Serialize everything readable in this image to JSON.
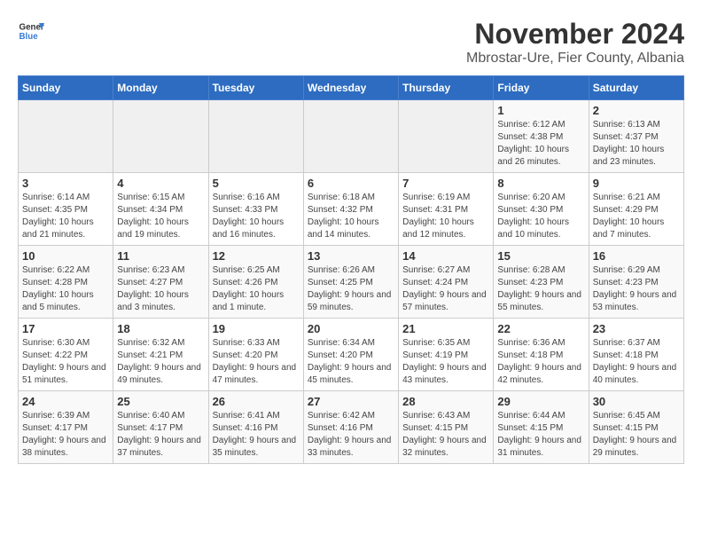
{
  "header": {
    "logo_general": "General",
    "logo_blue": "Blue",
    "main_title": "November 2024",
    "subtitle": "Mbrostar-Ure, Fier County, Albania"
  },
  "calendar": {
    "days_of_week": [
      "Sunday",
      "Monday",
      "Tuesday",
      "Wednesday",
      "Thursday",
      "Friday",
      "Saturday"
    ],
    "weeks": [
      [
        {
          "day": "",
          "info": ""
        },
        {
          "day": "",
          "info": ""
        },
        {
          "day": "",
          "info": ""
        },
        {
          "day": "",
          "info": ""
        },
        {
          "day": "",
          "info": ""
        },
        {
          "day": "1",
          "info": "Sunrise: 6:12 AM\nSunset: 4:38 PM\nDaylight: 10 hours and 26 minutes."
        },
        {
          "day": "2",
          "info": "Sunrise: 6:13 AM\nSunset: 4:37 PM\nDaylight: 10 hours and 23 minutes."
        }
      ],
      [
        {
          "day": "3",
          "info": "Sunrise: 6:14 AM\nSunset: 4:35 PM\nDaylight: 10 hours and 21 minutes."
        },
        {
          "day": "4",
          "info": "Sunrise: 6:15 AM\nSunset: 4:34 PM\nDaylight: 10 hours and 19 minutes."
        },
        {
          "day": "5",
          "info": "Sunrise: 6:16 AM\nSunset: 4:33 PM\nDaylight: 10 hours and 16 minutes."
        },
        {
          "day": "6",
          "info": "Sunrise: 6:18 AM\nSunset: 4:32 PM\nDaylight: 10 hours and 14 minutes."
        },
        {
          "day": "7",
          "info": "Sunrise: 6:19 AM\nSunset: 4:31 PM\nDaylight: 10 hours and 12 minutes."
        },
        {
          "day": "8",
          "info": "Sunrise: 6:20 AM\nSunset: 4:30 PM\nDaylight: 10 hours and 10 minutes."
        },
        {
          "day": "9",
          "info": "Sunrise: 6:21 AM\nSunset: 4:29 PM\nDaylight: 10 hours and 7 minutes."
        }
      ],
      [
        {
          "day": "10",
          "info": "Sunrise: 6:22 AM\nSunset: 4:28 PM\nDaylight: 10 hours and 5 minutes."
        },
        {
          "day": "11",
          "info": "Sunrise: 6:23 AM\nSunset: 4:27 PM\nDaylight: 10 hours and 3 minutes."
        },
        {
          "day": "12",
          "info": "Sunrise: 6:25 AM\nSunset: 4:26 PM\nDaylight: 10 hours and 1 minute."
        },
        {
          "day": "13",
          "info": "Sunrise: 6:26 AM\nSunset: 4:25 PM\nDaylight: 9 hours and 59 minutes."
        },
        {
          "day": "14",
          "info": "Sunrise: 6:27 AM\nSunset: 4:24 PM\nDaylight: 9 hours and 57 minutes."
        },
        {
          "day": "15",
          "info": "Sunrise: 6:28 AM\nSunset: 4:23 PM\nDaylight: 9 hours and 55 minutes."
        },
        {
          "day": "16",
          "info": "Sunrise: 6:29 AM\nSunset: 4:23 PM\nDaylight: 9 hours and 53 minutes."
        }
      ],
      [
        {
          "day": "17",
          "info": "Sunrise: 6:30 AM\nSunset: 4:22 PM\nDaylight: 9 hours and 51 minutes."
        },
        {
          "day": "18",
          "info": "Sunrise: 6:32 AM\nSunset: 4:21 PM\nDaylight: 9 hours and 49 minutes."
        },
        {
          "day": "19",
          "info": "Sunrise: 6:33 AM\nSunset: 4:20 PM\nDaylight: 9 hours and 47 minutes."
        },
        {
          "day": "20",
          "info": "Sunrise: 6:34 AM\nSunset: 4:20 PM\nDaylight: 9 hours and 45 minutes."
        },
        {
          "day": "21",
          "info": "Sunrise: 6:35 AM\nSunset: 4:19 PM\nDaylight: 9 hours and 43 minutes."
        },
        {
          "day": "22",
          "info": "Sunrise: 6:36 AM\nSunset: 4:18 PM\nDaylight: 9 hours and 42 minutes."
        },
        {
          "day": "23",
          "info": "Sunrise: 6:37 AM\nSunset: 4:18 PM\nDaylight: 9 hours and 40 minutes."
        }
      ],
      [
        {
          "day": "24",
          "info": "Sunrise: 6:39 AM\nSunset: 4:17 PM\nDaylight: 9 hours and 38 minutes."
        },
        {
          "day": "25",
          "info": "Sunrise: 6:40 AM\nSunset: 4:17 PM\nDaylight: 9 hours and 37 minutes."
        },
        {
          "day": "26",
          "info": "Sunrise: 6:41 AM\nSunset: 4:16 PM\nDaylight: 9 hours and 35 minutes."
        },
        {
          "day": "27",
          "info": "Sunrise: 6:42 AM\nSunset: 4:16 PM\nDaylight: 9 hours and 33 minutes."
        },
        {
          "day": "28",
          "info": "Sunrise: 6:43 AM\nSunset: 4:15 PM\nDaylight: 9 hours and 32 minutes."
        },
        {
          "day": "29",
          "info": "Sunrise: 6:44 AM\nSunset: 4:15 PM\nDaylight: 9 hours and 31 minutes."
        },
        {
          "day": "30",
          "info": "Sunrise: 6:45 AM\nSunset: 4:15 PM\nDaylight: 9 hours and 29 minutes."
        }
      ]
    ]
  }
}
